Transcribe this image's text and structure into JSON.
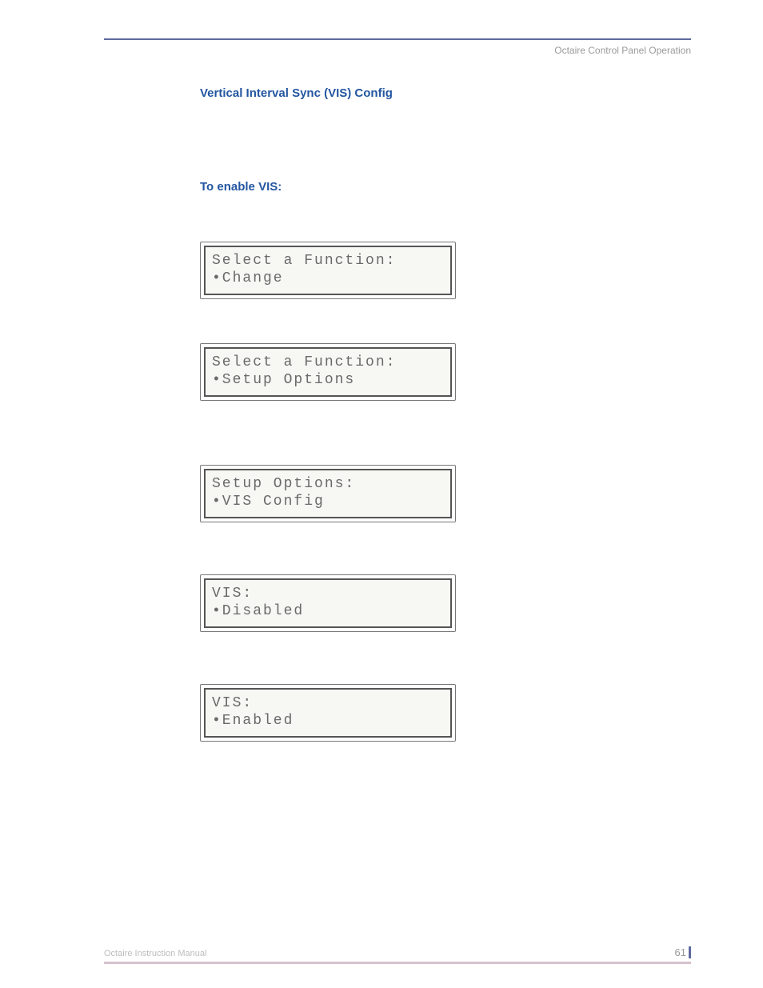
{
  "header": {
    "right": "Octaire Control Panel Operation"
  },
  "section": {
    "title": "Vertical Interval Sync (VIS) Config"
  },
  "subsection": {
    "title": "To enable VIS:"
  },
  "lcd": [
    {
      "line1": "Select a Function:",
      "line2": "•Change"
    },
    {
      "line1": "Select a Function:",
      "line2": "•Setup Options"
    },
    {
      "line1": "Setup Options:",
      "line2": "•VIS Config"
    },
    {
      "line1": "VIS:",
      "line2": "•Disabled"
    },
    {
      "line1": "VIS:",
      "line2": "•Enabled"
    }
  ],
  "footer": {
    "left": "Octaire Instruction Manual",
    "page": "61"
  }
}
